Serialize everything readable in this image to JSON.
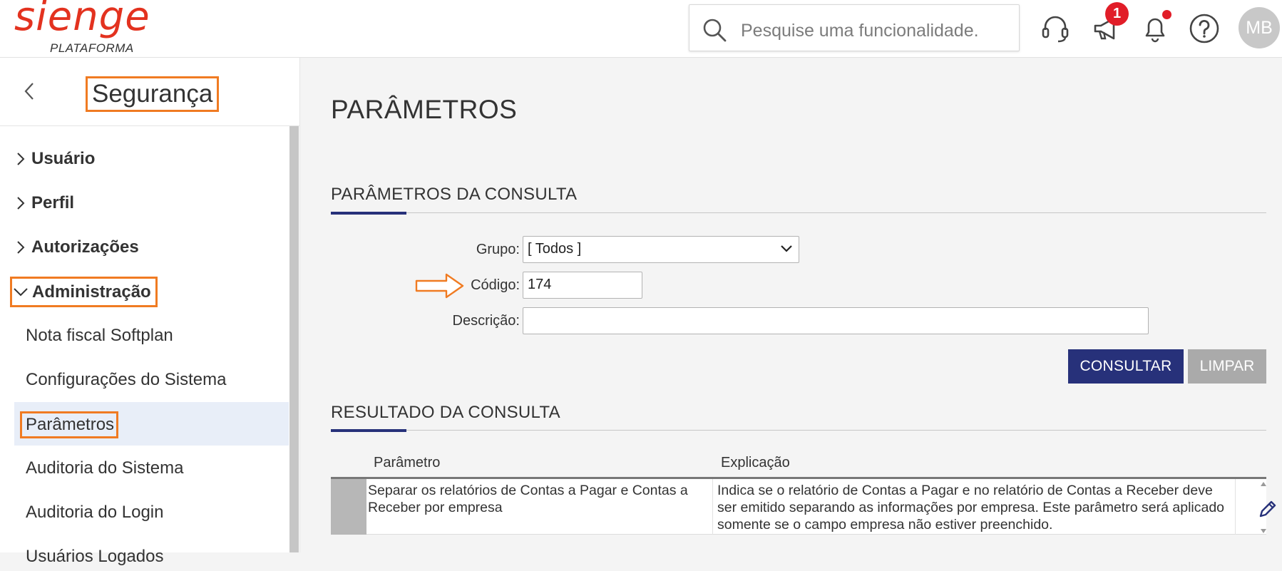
{
  "header": {
    "logo_text": "sienge",
    "logo_sub": "PLATAFORMA",
    "search_placeholder": "Pesquise uma funcionalidade.",
    "notification_count": "1",
    "avatar_initials": "MB"
  },
  "sidebar": {
    "title": "Segurança",
    "groups": [
      {
        "label": "Usuário"
      },
      {
        "label": "Perfil"
      },
      {
        "label": "Autorizações"
      },
      {
        "label": "Administração"
      }
    ],
    "items": [
      {
        "label": "Nota fiscal Softplan"
      },
      {
        "label": "Configurações do Sistema"
      },
      {
        "label": "Parâmetros"
      },
      {
        "label": "Auditoria do Sistema"
      },
      {
        "label": "Auditoria do Login"
      },
      {
        "label": "Usuários Logados"
      }
    ]
  },
  "main": {
    "page_title": "PARÂMETROS",
    "query_section": "PARÂMETROS DA CONSULTA",
    "form": {
      "grupo_label": "Grupo:",
      "grupo_value": "[ Todos ]",
      "codigo_label": "Código:",
      "codigo_value": "174",
      "descricao_label": "Descrição:",
      "descricao_value": ""
    },
    "buttons": {
      "consultar": "CONSULTAR",
      "limpar": "LIMPAR"
    },
    "result_section": "RESULTADO DA CONSULTA",
    "table": {
      "columns": [
        "Parâmetro",
        "Explicação"
      ],
      "rows": [
        {
          "parametro": "Separar os relatórios de Contas a Pagar e Contas a Receber por empresa",
          "explicacao": "Indica se o relatório de Contas a Pagar e no relatório de Contas a Receber deve ser emitido separando as informações por empresa. Este parâmetro será aplicado somente se o campo empresa não estiver preenchido."
        }
      ]
    }
  },
  "colors": {
    "brand_red": "#e3321f",
    "primary_blue": "#27317a",
    "highlight_orange": "#f07b22"
  }
}
